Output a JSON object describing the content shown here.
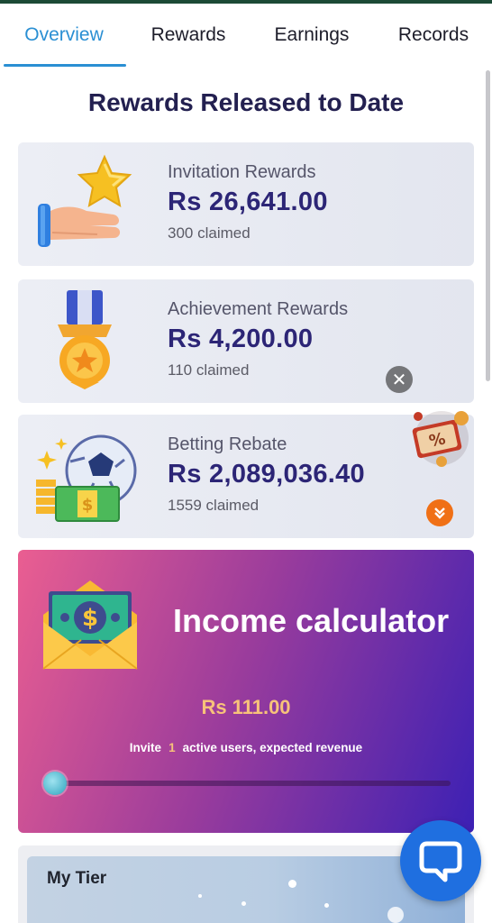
{
  "tabs": [
    {
      "label": "Overview",
      "active": true
    },
    {
      "label": "Rewards",
      "active": false
    },
    {
      "label": "Earnings",
      "active": false
    },
    {
      "label": "Records",
      "active": false
    }
  ],
  "section_title": "Rewards Released to Date",
  "cards": [
    {
      "name": "Invitation Rewards",
      "amount": "Rs  26,641.00",
      "claimed": "300 claimed",
      "icon": "hand-star-icon"
    },
    {
      "name": "Achievement Rewards",
      "amount": "Rs  4,200.00",
      "claimed": "110 claimed",
      "icon": "medal-icon"
    },
    {
      "name": "Betting Rebate",
      "amount": "Rs  2,089,036.40",
      "claimed": "1559 claimed",
      "icon": "soccer-money-icon"
    }
  ],
  "calculator": {
    "title": "Income calculator",
    "amount": "Rs  111.00",
    "desc_before": "Invite",
    "invite_count": "1",
    "desc_after": "active users, expected revenue",
    "slider_level": 1
  },
  "tier": {
    "title": "My Tier"
  },
  "colors": {
    "accent": "#2a8fd3",
    "amount_text": "#2c2576",
    "calc_gold": "#f7c27a",
    "chat_button": "#1f6fe0",
    "expand_button": "#f07016"
  }
}
